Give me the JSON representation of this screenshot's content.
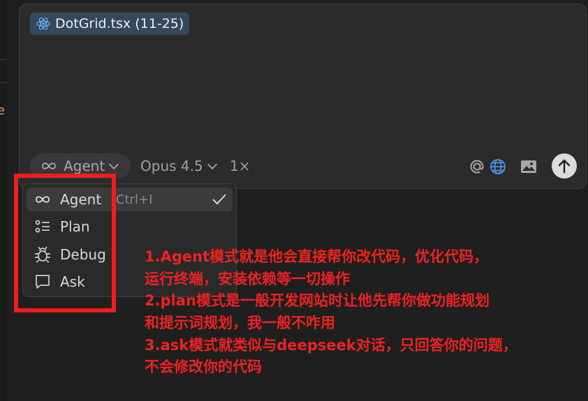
{
  "composer": {
    "context_chip": {
      "icon": "react-icon",
      "label": "DotGrid.tsx (11-25)"
    },
    "mode_pill": {
      "icon": "infinity-icon",
      "label": "Agent"
    },
    "model": "Opus 4.5",
    "speed": "1×",
    "right_icons": [
      "at-icon",
      "globe-icon",
      "image-icon",
      "send-arrow-icon"
    ]
  },
  "mode_menu": {
    "shortcut": "Ctrl+I",
    "items": [
      {
        "icon": "infinity-icon",
        "label": "Agent",
        "selected": true
      },
      {
        "icon": "list-icon",
        "label": "Plan"
      },
      {
        "icon": "bug-icon",
        "label": "Debug"
      },
      {
        "icon": "chat-bubble-icon",
        "label": "Ask"
      }
    ]
  },
  "left_edge": {
    "glyph": "e"
  },
  "annotation": {
    "color": "#ee2222",
    "lines": [
      "1.Agent模式就是他会直接帮你改代码，优化代码，",
      "运行终端，安装依赖等一切操作",
      "2.plan模式是一般开发网站时让他先帮你做功能规划",
      "和提示词规划，我一般不咋用",
      "3.ask模式就类似与deepseek对话，只回答你的问题，",
      "不会修改你的代码"
    ]
  }
}
